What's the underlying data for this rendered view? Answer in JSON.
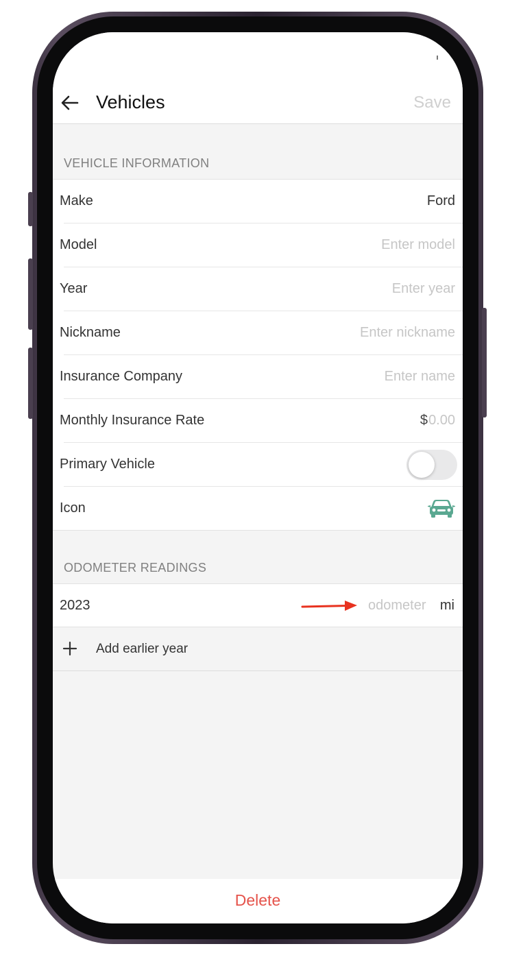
{
  "navbar": {
    "title": "Vehicles",
    "save_label": "Save"
  },
  "vehicle_info": {
    "header": "VEHICLE INFORMATION",
    "make": {
      "label": "Make",
      "value": "Ford"
    },
    "model": {
      "label": "Model",
      "placeholder": "Enter model"
    },
    "year": {
      "label": "Year",
      "placeholder": "Enter year"
    },
    "nickname": {
      "label": "Nickname",
      "placeholder": "Enter nickname"
    },
    "insurance_company": {
      "label": "Insurance Company",
      "placeholder": "Enter name"
    },
    "monthly_rate": {
      "label": "Monthly Insurance Rate",
      "currency": "$",
      "placeholder": "0.00"
    },
    "primary_vehicle": {
      "label": "Primary Vehicle",
      "on": false
    },
    "icon": {
      "label": "Icon",
      "icon_name": "car-icon",
      "color": "#5aa891"
    }
  },
  "odometer": {
    "header": "ODOMETER READINGS",
    "readings": [
      {
        "year": "2023",
        "placeholder": "odometer",
        "unit": "mi"
      }
    ],
    "add_label": "Add earlier year",
    "arrow_color": "#e8321f"
  },
  "footer": {
    "delete_label": "Delete",
    "delete_color": "#e5534b"
  }
}
